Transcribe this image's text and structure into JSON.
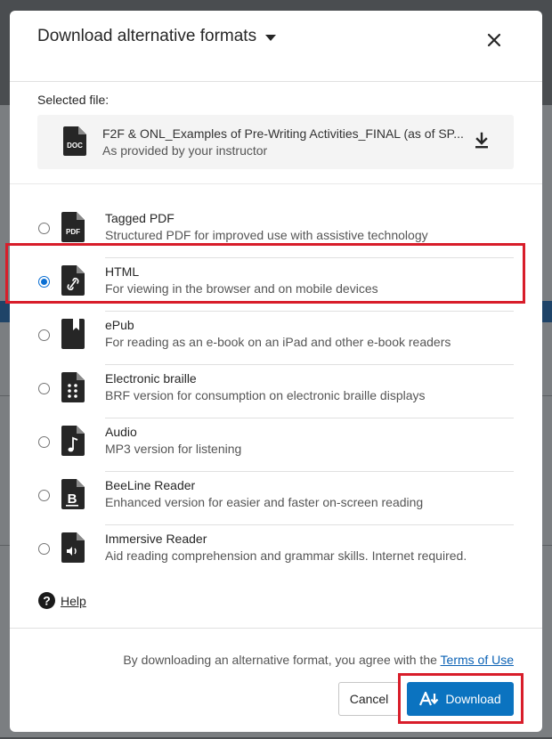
{
  "modal": {
    "title": "Download alternative formats",
    "selected_label": "Selected file:",
    "file": {
      "name": "F2F & ONL_Examples of Pre-Writing Activities_FINAL (as of SP...",
      "subtitle": "As provided by your instructor",
      "icon": "doc-file-icon"
    },
    "formats": [
      {
        "name": "Tagged PDF",
        "description": "Structured PDF for improved use with assistive technology",
        "icon": "pdf-file-icon",
        "selected": false
      },
      {
        "name": "HTML",
        "description": "For viewing in the browser and on mobile devices",
        "icon": "link-file-icon",
        "selected": true
      },
      {
        "name": "ePub",
        "description": "For reading as an e-book on an iPad and other e-book readers",
        "icon": "bookmark-file-icon",
        "selected": false
      },
      {
        "name": "Electronic braille",
        "description": "BRF version for consumption on electronic braille displays",
        "icon": "braille-file-icon",
        "selected": false
      },
      {
        "name": "Audio",
        "description": "MP3 version for listening",
        "icon": "music-file-icon",
        "selected": false
      },
      {
        "name": "BeeLine Reader",
        "description": "Enhanced version for easier and faster on-screen reading",
        "icon": "beeline-file-icon",
        "selected": false
      },
      {
        "name": "Immersive Reader",
        "description": "Aid reading comprehension and grammar skills. Internet required.",
        "icon": "speaker-file-icon",
        "selected": false
      }
    ],
    "help_label": "Help",
    "terms_prefix": "By downloading an alternative format, you agree with the",
    "terms_link": "Terms of Use",
    "cancel_label": "Cancel",
    "download_label": "Download"
  },
  "colors": {
    "primary": "#0b73c0",
    "highlight": "#d81d2a",
    "link": "#0b62b5"
  }
}
